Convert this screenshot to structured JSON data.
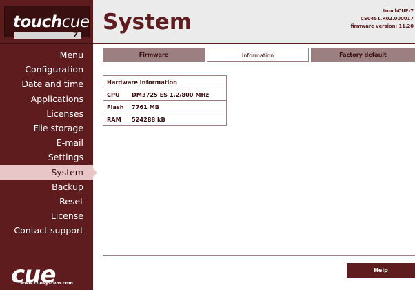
{
  "logo": {
    "brand_bold": "touch",
    "brand_light": "cue",
    "model_digit": "7"
  },
  "sidebar": {
    "items": [
      {
        "label": "Menu"
      },
      {
        "label": "Configuration"
      },
      {
        "label": "Date and time"
      },
      {
        "label": "Applications"
      },
      {
        "label": "Licenses"
      },
      {
        "label": "File storage"
      },
      {
        "label": "E-mail"
      },
      {
        "label": "Settings"
      },
      {
        "label": "System",
        "active": true
      },
      {
        "label": "Backup"
      },
      {
        "label": "Reset"
      },
      {
        "label": "License"
      },
      {
        "label": "Contact support"
      }
    ],
    "footer_logo": "cue",
    "footer_url": "www.cuesystem.com"
  },
  "header": {
    "title": "System",
    "device_name": "touchCUE-7",
    "serial": "CS0451.R02.000017",
    "firmware": "firmware version: 11.20"
  },
  "tabs": [
    {
      "label": "Firmware"
    },
    {
      "label": "Information",
      "active": true
    },
    {
      "label": "Factory default"
    }
  ],
  "hardware": {
    "heading": "Hardware information",
    "rows": [
      {
        "label": "CPU",
        "value": "DM3725 ES 1.2/800 MHz"
      },
      {
        "label": "Flash",
        "value": "7761 MB"
      },
      {
        "label": "RAM",
        "value": "524288 kB"
      }
    ]
  },
  "help_label": "Help",
  "colors": {
    "brand": "#5e1c1e",
    "sidebar_active": "#e8c6c7",
    "tab_inactive": "#9c7f80",
    "header_bg": "#ebebeb"
  }
}
